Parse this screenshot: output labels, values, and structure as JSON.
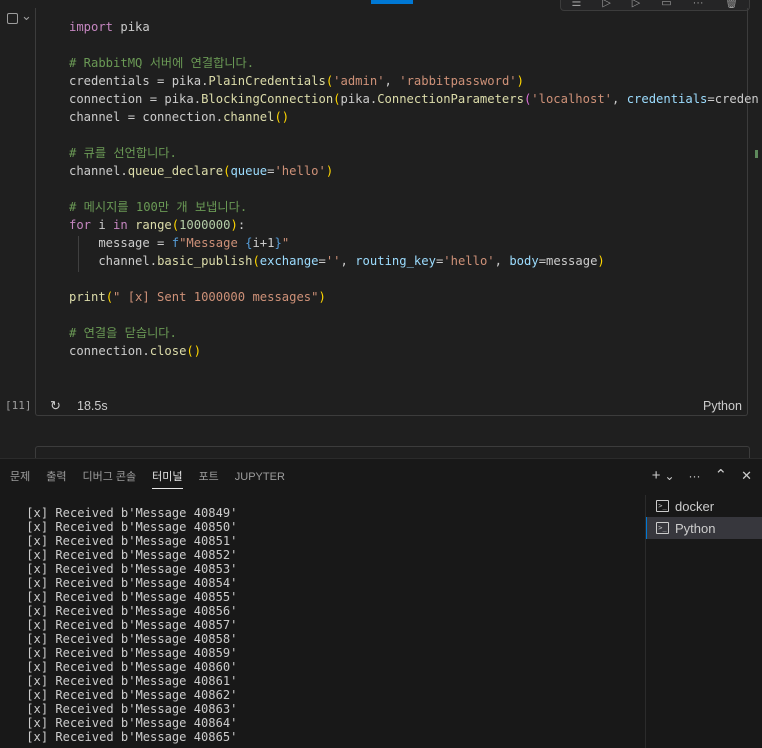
{
  "notebook": {
    "cell": {
      "exec_count": "[11]",
      "exec_time": "18.5s",
      "language": "Python",
      "code_lines": [
        [
          [
            "kw",
            "import"
          ],
          [
            "vn",
            " pika"
          ]
        ],
        [],
        [
          [
            "cm",
            "# RabbitMQ 서버에 연결합니다."
          ]
        ],
        [
          [
            "vn",
            "credentials = pika."
          ],
          [
            "fn",
            "PlainCredentials"
          ],
          [
            "par",
            "("
          ],
          [
            "str",
            "'admin'"
          ],
          [
            "vn",
            ", "
          ],
          [
            "str",
            "'rabbitpassword'"
          ],
          [
            "par",
            ")"
          ]
        ],
        [
          [
            "vn",
            "connection = pika."
          ],
          [
            "fn",
            "BlockingConnection"
          ],
          [
            "par",
            "("
          ],
          [
            "vn",
            "pika."
          ],
          [
            "fn",
            "ConnectionParameters"
          ],
          [
            "par2",
            "("
          ],
          [
            "str",
            "'localhost'"
          ],
          [
            "vn",
            ", "
          ],
          [
            "var",
            "credentials"
          ],
          [
            "vn",
            "=creden"
          ]
        ],
        [
          [
            "vn",
            "channel = connection."
          ],
          [
            "fn",
            "channel"
          ],
          [
            "par",
            "()"
          ]
        ],
        [],
        [
          [
            "cm",
            "# 큐를 선언합니다."
          ]
        ],
        [
          [
            "vn",
            "channel."
          ],
          [
            "fn",
            "queue_declare"
          ],
          [
            "par",
            "("
          ],
          [
            "var",
            "queue"
          ],
          [
            "vn",
            "="
          ],
          [
            "str",
            "'hello'"
          ],
          [
            "par",
            ")"
          ]
        ],
        [],
        [
          [
            "cm",
            "# 메시지를 100만 개 보냅니다."
          ]
        ],
        [
          [
            "ctl",
            "for"
          ],
          [
            "vn",
            " i "
          ],
          [
            "ctl",
            "in"
          ],
          [
            "vn",
            " "
          ],
          [
            "fn",
            "range"
          ],
          [
            "par",
            "("
          ],
          [
            "num",
            "1000000"
          ],
          [
            "par",
            ")"
          ],
          [
            "vn",
            ":"
          ]
        ],
        [
          [
            "vn",
            "    message = "
          ],
          [
            "brace",
            "f"
          ],
          [
            "str",
            "\"Message "
          ],
          [
            "brace",
            "{"
          ],
          [
            "vn",
            "i+1"
          ],
          [
            "brace",
            "}"
          ],
          [
            "str",
            "\""
          ]
        ],
        [
          [
            "vn",
            "    channel."
          ],
          [
            "fn",
            "basic_publish"
          ],
          [
            "par",
            "("
          ],
          [
            "var",
            "exchange"
          ],
          [
            "vn",
            "="
          ],
          [
            "str",
            "''"
          ],
          [
            "vn",
            ", "
          ],
          [
            "var",
            "routing_key"
          ],
          [
            "vn",
            "="
          ],
          [
            "str",
            "'hello'"
          ],
          [
            "vn",
            ", "
          ],
          [
            "var",
            "body"
          ],
          [
            "vn",
            "=message"
          ],
          [
            "par",
            ")"
          ]
        ],
        [],
        [
          [
            "fn",
            "print"
          ],
          [
            "par",
            "("
          ],
          [
            "str",
            "\" [x] Sent 1000000 messages\""
          ],
          [
            "par",
            ")"
          ]
        ],
        [],
        [
          [
            "cm",
            "# 연결을 닫습니다."
          ]
        ],
        [
          [
            "vn",
            "connection."
          ],
          [
            "fn",
            "close"
          ],
          [
            "par",
            "()"
          ]
        ]
      ]
    }
  },
  "panel": {
    "tabs": [
      "문제",
      "출력",
      "디버그 콘솔",
      "터미널",
      "포트",
      "JUPYTER"
    ],
    "active_tab": "터미널",
    "actions": {
      "add": "+",
      "dropdown": "⌄",
      "more": "···",
      "maximize": "⌃",
      "close": "✕"
    },
    "terminal_lines": [
      " [x] Received b'Message 40849'",
      " [x] Received b'Message 40850'",
      " [x] Received b'Message 40851'",
      " [x] Received b'Message 40852'",
      " [x] Received b'Message 40853'",
      " [x] Received b'Message 40854'",
      " [x] Received b'Message 40855'",
      " [x] Received b'Message 40856'",
      " [x] Received b'Message 40857'",
      " [x] Received b'Message 40858'",
      " [x] Received b'Message 40859'",
      " [x] Received b'Message 40860'",
      " [x] Received b'Message 40861'",
      " [x] Received b'Message 40862'",
      " [x] Received b'Message 40863'",
      " [x] Received b'Message 40864'",
      " [x] Received b'Message 40865'"
    ],
    "terminals": [
      {
        "label": "docker",
        "selected": false,
        "icon": "terminal-icon"
      },
      {
        "label": "Python",
        "selected": true,
        "icon": "terminal-icon"
      }
    ]
  },
  "colors": {
    "accent": "#0078d4",
    "background": "#1f1f1f",
    "panel_background": "#181818"
  }
}
